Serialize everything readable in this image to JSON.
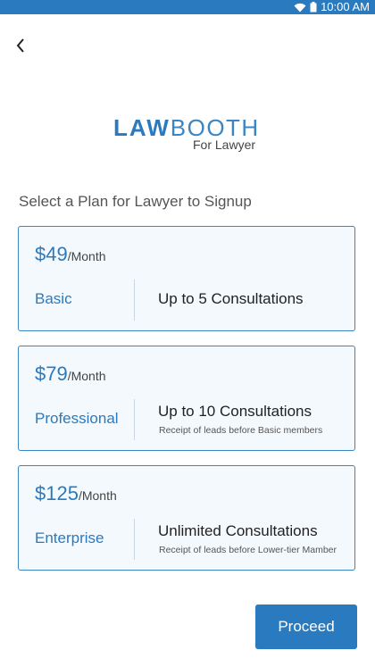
{
  "status_bar": {
    "time": "10:00 AM"
  },
  "logo": {
    "law": "LAW",
    "booth": "BOOTH",
    "sub": "For Lawyer"
  },
  "section_title": "Select a Plan for Lawyer to Signup",
  "plans": [
    {
      "price": "$49",
      "period": "/Month",
      "name": "Basic",
      "feature": "Up to 5 Consultations",
      "note": ""
    },
    {
      "price": "$79",
      "period": "/Month",
      "name": "Professional",
      "feature": "Up to 10 Consultations",
      "note": "Receipt of leads before Basic members"
    },
    {
      "price": "$125",
      "period": "/Month",
      "name": "Enterprise",
      "feature": "Unlimited Consultations",
      "note": "Receipt of leads before Lower-tier Mamber"
    }
  ],
  "proceed_label": "Proceed",
  "colors": {
    "accent": "#2a7abf",
    "card_bg": "#f4f9fd"
  },
  "icons": {
    "back": "chevron-left-icon",
    "wifi": "wifi-icon",
    "battery": "battery-icon"
  }
}
